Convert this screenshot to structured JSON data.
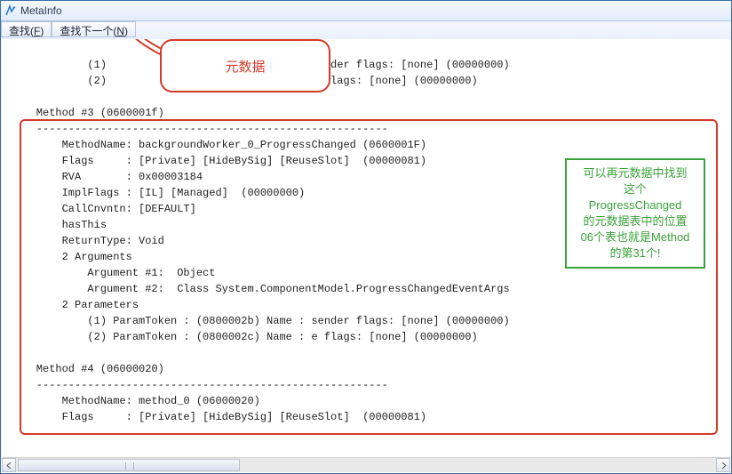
{
  "window": {
    "title": "MetaInfo"
  },
  "toolbar": {
    "find_prefix": "查找(",
    "find_key": "F",
    "find_suffix": ")",
    "findnext_prefix": "查找下一个(",
    "findnext_key": "N",
    "findnext_suffix": ")"
  },
  "callout": {
    "label": "元数据"
  },
  "green_note": {
    "l1": "可以再元数据中找到",
    "l2": "这个",
    "l3": "ProgressChanged",
    "l4": "的元数据表中的位置",
    "l5": "06个表也就是Method",
    "l6": "的第31个!"
  },
  "top_lines": {
    "l1": "            (1)                         Name : sender flags: [none] (00000000)",
    "l2": "            (2)                         Name : e flags: [none] (00000000)"
  },
  "method3": {
    "header": "    Method #3 (0600001f)",
    "sep": "    -------------------------------------------------------",
    "name": "        MethodName: backgroundWorker_0_ProgressChanged (0600001F)",
    "flags": "        Flags     : [Private] [HideBySig] [ReuseSlot]  (00000081)",
    "rva": "        RVA       : 0x00003184",
    "impl": "        ImplFlags : [IL] [Managed]  (00000000)",
    "call": "        CallCnvntn: [DEFAULT]",
    "hasthis": "        hasThis",
    "ret": "        ReturnType: Void",
    "args": "        2 Arguments",
    "arg1": "            Argument #1:  Object",
    "arg2": "            Argument #2:  Class System.ComponentModel.ProgressChangedEventArgs",
    "params": "        2 Parameters",
    "p1": "            (1) ParamToken : (0800002b) Name : sender flags: [none] (00000000)",
    "p2": "            (2) ParamToken : (0800002c) Name : e flags: [none] (00000000)"
  },
  "method4": {
    "header": "    Method #4 (06000020)",
    "sep": "    -------------------------------------------------------",
    "name": "        MethodName: method_0 (06000020)",
    "flags": "        Flags     : [Private] [HideBySig] [ReuseSlot]  (00000081)"
  }
}
